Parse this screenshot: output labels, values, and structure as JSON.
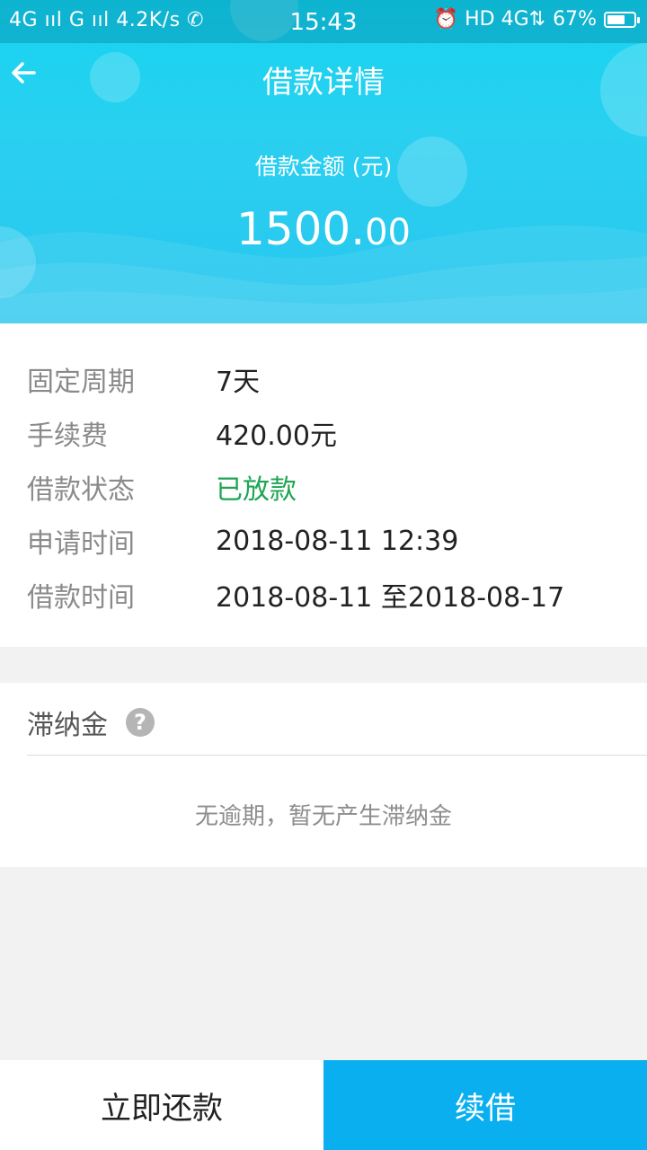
{
  "status_bar": {
    "left": "4G ııl G ııl 4.2K/s ✆",
    "time": "15:43",
    "right_icons": "⏰ HD 4G⇅",
    "battery": "67%",
    "battery_level": 0.67
  },
  "header": {
    "title": "借款详情",
    "amount_label": "借款金额 (元)",
    "amount_int": "1500.",
    "amount_dec": "00"
  },
  "details": [
    {
      "label": "固定周期",
      "value": "7天"
    },
    {
      "label": "手续费",
      "value": "420.00元"
    },
    {
      "label": "借款状态",
      "value": "已放款"
    },
    {
      "label": "申请时间",
      "value": "2018-08-11 12:39"
    },
    {
      "label": "借款时间",
      "value": "2018-08-11 至2018-08-17"
    }
  ],
  "late_fee": {
    "title": "滞纳金",
    "help_icon": "?",
    "message": "无逾期，暂无产生滞纳金"
  },
  "buttons": {
    "repay": "立即还款",
    "renew": "续借"
  },
  "colors": {
    "header_gradient": "#14d4f0",
    "status_green": "#1ea654",
    "renew_button": "#0aaff0"
  }
}
